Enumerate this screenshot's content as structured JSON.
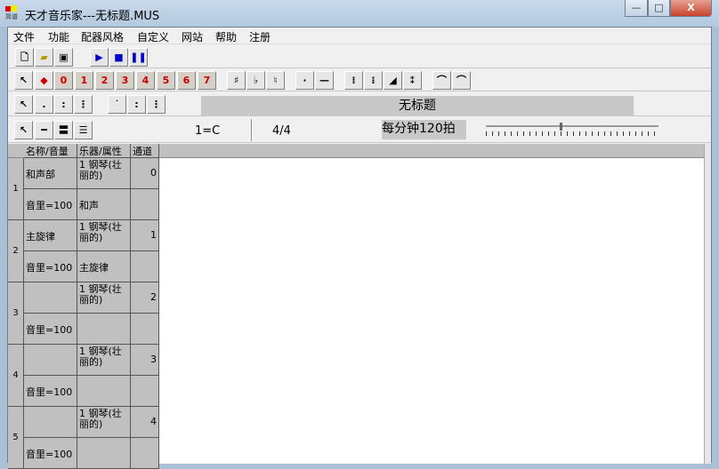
{
  "window": {
    "title": "天才音乐家---无标题.MUS",
    "icon_text": "简谱",
    "minimize": "—",
    "maximize": "□",
    "close": "X"
  },
  "menu": [
    "文件",
    "功能",
    "配器风格",
    "自定义",
    "网站",
    "帮助",
    "注册"
  ],
  "toolbar2_numbers": [
    "0",
    "1",
    "2",
    "3",
    "4",
    "5",
    "6",
    "7"
  ],
  "toolbar2_symbols": [
    "♯",
    "♭",
    "♮",
    "·",
    "—"
  ],
  "score": {
    "title": "无标题",
    "key": "1=C",
    "time_signature": "4/4",
    "tempo": "每分钟120拍",
    "tempo_slider_fraction": 0.43
  },
  "grid": {
    "headers": [
      "名称/音量",
      "乐器/属性",
      "通道"
    ],
    "rows": [
      {
        "num": "1",
        "name": "和声部",
        "volume": "音里=100",
        "instrument": "1 钢琴(壮丽的)",
        "attr": "和声",
        "channel": "0"
      },
      {
        "num": "2",
        "name": "主旋律",
        "volume": "音里=100",
        "instrument": "1 钢琴(壮丽的)",
        "attr": "主旋律",
        "channel": "1"
      },
      {
        "num": "3",
        "name": "",
        "volume": "音里=100",
        "instrument": "1 钢琴(壮丽的)",
        "attr": "",
        "channel": "2"
      },
      {
        "num": "4",
        "name": "",
        "volume": "音里=100",
        "instrument": "1 钢琴(壮丽的)",
        "attr": "",
        "channel": "3"
      },
      {
        "num": "5",
        "name": "",
        "volume": "音里=100",
        "instrument": "1 钢琴(壮丽的)",
        "attr": "",
        "channel": "4"
      }
    ]
  }
}
